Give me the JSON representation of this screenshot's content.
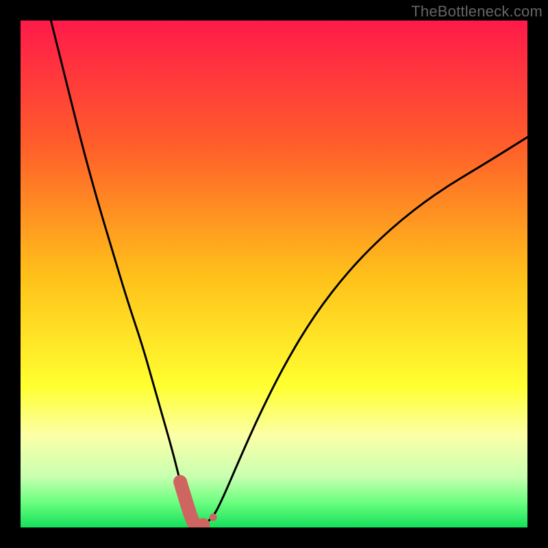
{
  "watermark": "TheBottleneck.com",
  "colors": {
    "frame": "#000000",
    "curve": "#000000",
    "marker": "#cf6560",
    "gradient_stops": [
      {
        "offset": 0.0,
        "color": "#ff1a4a"
      },
      {
        "offset": 0.25,
        "color": "#ff5f2a"
      },
      {
        "offset": 0.5,
        "color": "#ffbf1a"
      },
      {
        "offset": 0.72,
        "color": "#ffff30"
      },
      {
        "offset": 0.82,
        "color": "#fbffa8"
      },
      {
        "offset": 0.9,
        "color": "#c8ffb0"
      },
      {
        "offset": 0.95,
        "color": "#6cff80"
      },
      {
        "offset": 1.0,
        "color": "#15e05a"
      }
    ]
  },
  "chart_data": {
    "type": "line",
    "title": "",
    "xlabel": "",
    "ylabel": "",
    "xlim": [
      0,
      100
    ],
    "ylim": [
      0,
      100
    ],
    "series": [
      {
        "name": "bottleneck-curve",
        "x": [
          6,
          9,
          12,
          15,
          18,
          21,
          24,
          26,
          28,
          30,
          31.5,
          33,
          34,
          35,
          36,
          38,
          40,
          43,
          47,
          52,
          58,
          65,
          73,
          82,
          92,
          100
        ],
        "y": [
          100,
          88,
          76,
          65,
          55,
          45,
          36,
          29,
          22,
          15,
          9,
          4,
          1,
          0,
          0.5,
          2,
          6,
          13,
          22,
          32,
          42,
          51,
          59,
          66,
          72,
          77
        ]
      }
    ],
    "markers": {
      "name": "highlight-points",
      "x": [
        31.5,
        33,
        34,
        35,
        36,
        38
      ],
      "y": [
        9,
        4,
        1,
        0,
        0.5,
        2
      ],
      "radius": 10
    }
  }
}
